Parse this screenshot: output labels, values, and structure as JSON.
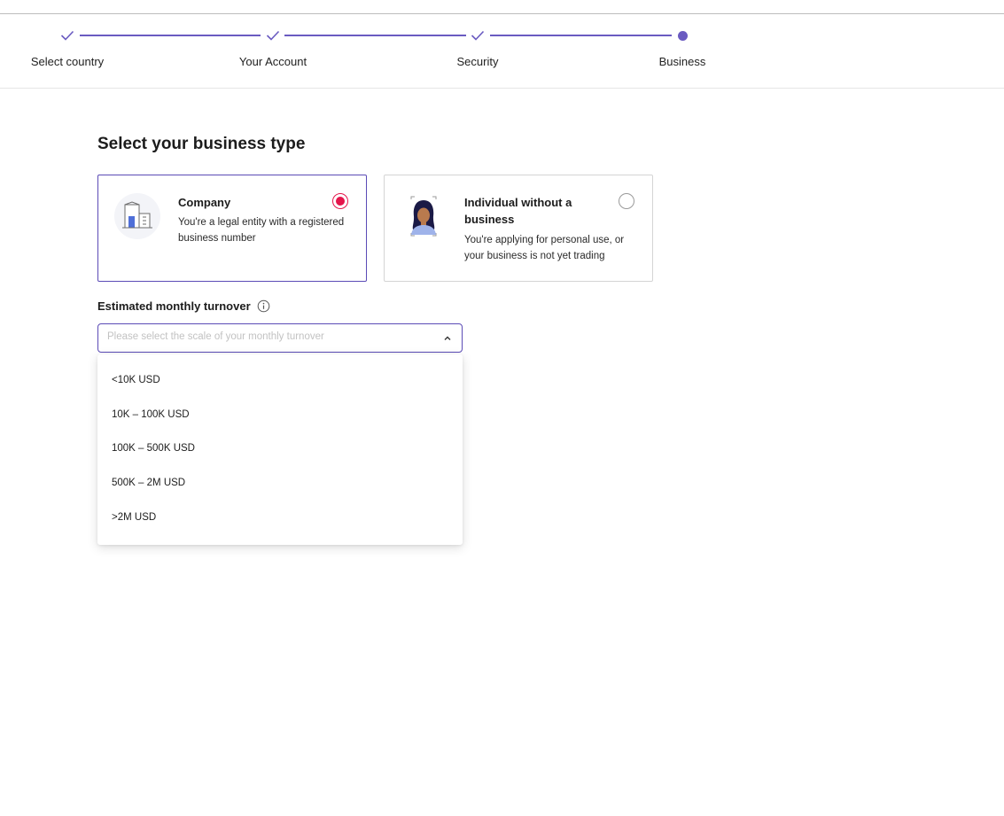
{
  "stepper": {
    "steps": [
      {
        "label": "Select country",
        "state": "completed"
      },
      {
        "label": "Your Account",
        "state": "completed"
      },
      {
        "label": "Security",
        "state": "completed"
      },
      {
        "label": "Business",
        "state": "current"
      }
    ],
    "accent_color": "#6a5bc1"
  },
  "page": {
    "title": "Select your business type"
  },
  "business_types": [
    {
      "title": "Company",
      "description": "You're a legal entity with a registered business number",
      "selected": true,
      "icon": "building-icon"
    },
    {
      "title": "Individual without a business",
      "description": "You're applying for personal use, or your business is not yet trading",
      "selected": false,
      "icon": "person-avatar-icon"
    }
  ],
  "turnover": {
    "label": "Estimated monthly turnover",
    "placeholder": "Please select the scale of your monthly turnover",
    "options": [
      "<10K USD",
      "10K – 100K USD",
      "100K – 500K USD",
      "500K – 2M USD",
      ">2M USD"
    ],
    "expanded": true
  },
  "colors": {
    "radio_selected": "#e4154b",
    "focus_border": "#5b4bb6"
  }
}
